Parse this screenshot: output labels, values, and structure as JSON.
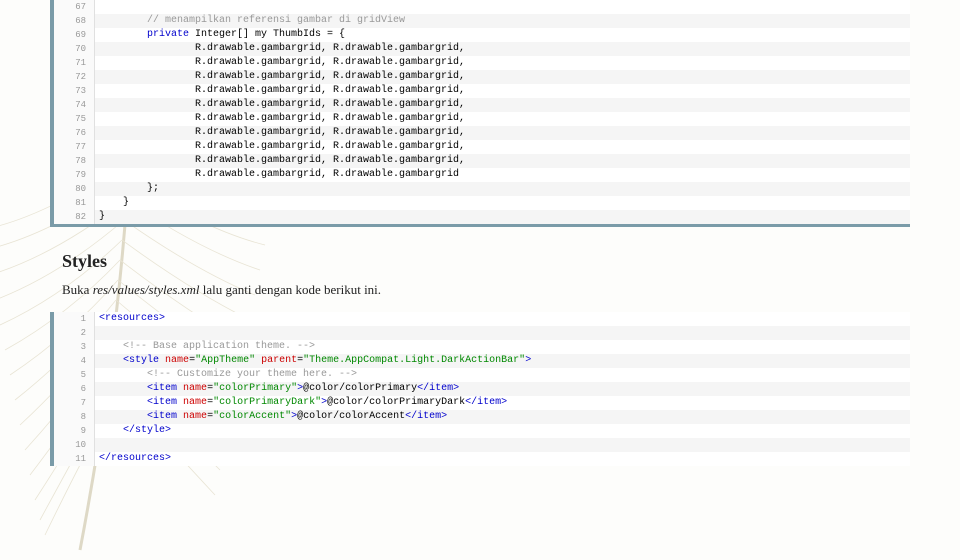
{
  "heading": "Styles",
  "body_prefix": "Buka ",
  "body_filename": "res/values/styles.xml",
  "body_suffix": " lalu ganti dengan kode berikut ini.",
  "block1": {
    "start": 67,
    "lines": [
      {
        "html": ""
      },
      {
        "html": "        <span class='com'>// menampilkan referensi gambar di gridView</span>"
      },
      {
        "html": "        <span class='kw'>private</span> Integer[] my ThumbIds = {"
      },
      {
        "html": "                R.drawable.gambargrid, R.drawable.gambargrid,"
      },
      {
        "html": "                R.drawable.gambargrid, R.drawable.gambargrid,"
      },
      {
        "html": "                R.drawable.gambargrid, R.drawable.gambargrid,"
      },
      {
        "html": "                R.drawable.gambargrid, R.drawable.gambargrid,"
      },
      {
        "html": "                R.drawable.gambargrid, R.drawable.gambargrid,"
      },
      {
        "html": "                R.drawable.gambargrid, R.drawable.gambargrid,"
      },
      {
        "html": "                R.drawable.gambargrid, R.drawable.gambargrid,"
      },
      {
        "html": "                R.drawable.gambargrid, R.drawable.gambargrid,"
      },
      {
        "html": "                R.drawable.gambargrid, R.drawable.gambargrid,"
      },
      {
        "html": "                R.drawable.gambargrid, R.drawable.gambargrid"
      },
      {
        "html": "        };"
      },
      {
        "html": "    }"
      },
      {
        "html": "}"
      }
    ]
  },
  "block2": {
    "start": 1,
    "lines": [
      {
        "html": "<span class='tag'>&lt;resources&gt;</span>"
      },
      {
        "html": ""
      },
      {
        "html": "    <span class='com'>&lt;!-- Base application theme. --&gt;</span>"
      },
      {
        "html": "    <span class='tag'>&lt;style</span> <span class='attr'>name</span>=<span class='str'>\"AppTheme\"</span> <span class='attr'>parent</span>=<span class='str'>\"Theme.AppCompat.Light.DarkActionBar\"</span><span class='tag'>&gt;</span>"
      },
      {
        "html": "        <span class='com'>&lt;!-- Customize your theme here. --&gt;</span>"
      },
      {
        "html": "        <span class='tag'>&lt;item</span> <span class='attr'>name</span>=<span class='str'>\"colorPrimary\"</span><span class='tag'>&gt;</span>@color/colorPrimary<span class='tag'>&lt;/item&gt;</span>"
      },
      {
        "html": "        <span class='tag'>&lt;item</span> <span class='attr'>name</span>=<span class='str'>\"colorPrimaryDark\"</span><span class='tag'>&gt;</span>@color/colorPrimaryDark<span class='tag'>&lt;/item&gt;</span>"
      },
      {
        "html": "        <span class='tag'>&lt;item</span> <span class='attr'>name</span>=<span class='str'>\"colorAccent\"</span><span class='tag'>&gt;</span>@color/colorAccent<span class='tag'>&lt;/item&gt;</span>"
      },
      {
        "html": "    <span class='tag'>&lt;/style&gt;</span>"
      },
      {
        "html": ""
      },
      {
        "html": "<span class='tag'>&lt;/resources&gt;</span>"
      }
    ]
  }
}
